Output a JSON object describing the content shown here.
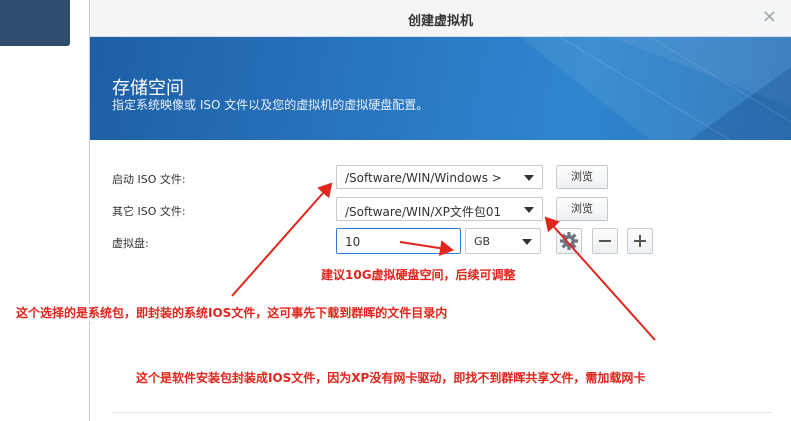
{
  "dialog": {
    "title": "创建虚拟机",
    "close_glyph": "×"
  },
  "banner": {
    "heading": "存储空间",
    "subtitle": "指定系统映像或 ISO 文件以及您的虚拟机的虚拟硬盘配置。"
  },
  "form": {
    "boot_iso_label": "启动 ISO 文件:",
    "boot_iso_value": "/Software/WIN/Windows >",
    "other_iso_label": "其它 ISO 文件:",
    "other_iso_value": "/Software/WIN/XP文件包01",
    "browse_label": "浏览",
    "vdisk_label": "虚拟盘:",
    "vdisk_size": "10",
    "vdisk_unit": "GB"
  },
  "annotations": {
    "disk_tip": "建议10G虚拟硬盘空间，后续可调整",
    "boot_tip": "这个选择的是系统包，即封装的系统IOS文件，这可事先下载到群晖的文件目录内",
    "other_tip": "这个是软件安装包封装成IOS文件，因为XP没有网卡驱动，即找不到群晖共享文件，需加载网卡"
  },
  "colors": {
    "annotation_red": "#e0261c",
    "banner_blue": "#2a78c2",
    "focus_blue": "#2e7bd6"
  }
}
